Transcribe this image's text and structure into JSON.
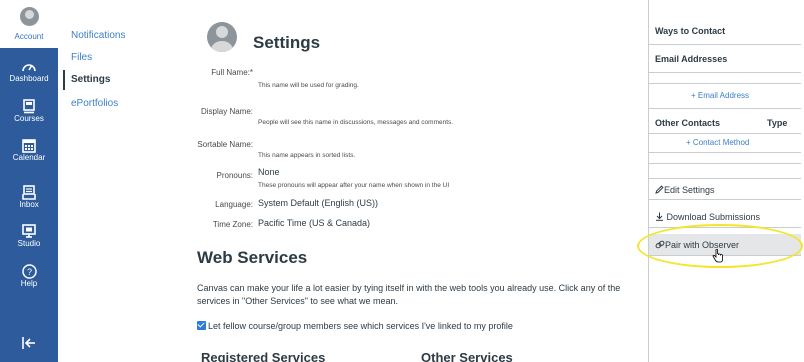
{
  "global_nav": {
    "account_label": "Account",
    "items": [
      {
        "label": "Dashboard",
        "icon": "dashboard-icon"
      },
      {
        "label": "Courses",
        "icon": "courses-icon"
      },
      {
        "label": "Calendar",
        "icon": "calendar-icon"
      },
      {
        "label": "Inbox",
        "icon": "inbox-icon"
      },
      {
        "label": "Studio",
        "icon": "studio-icon"
      },
      {
        "label": "Help",
        "icon": "help-icon"
      }
    ],
    "collapse_icon": "collapse-icon"
  },
  "left_menu": {
    "items": [
      "Notifications",
      "Files",
      "Settings",
      "ePortfolios"
    ],
    "active": "Settings"
  },
  "main": {
    "title": "Settings",
    "fields": {
      "full_name_label": "Full Name:*",
      "full_name_hint": "This name will be used for grading.",
      "display_name_label": "Display Name:",
      "display_name_hint": "People will see this name in discussions, messages and comments.",
      "sortable_name_label": "Sortable Name:",
      "sortable_name_hint": "This name appears in sorted lists.",
      "pronouns_label": "Pronouns:",
      "pronouns_value": "None",
      "pronouns_hint": "These pronouns will appear after your name when shown in the UI",
      "language_label": "Language:",
      "language_value": "System Default (English (US))",
      "timezone_label": "Time Zone:",
      "timezone_value": "Pacific Time (US & Canada)"
    },
    "web_services": {
      "title": "Web Services",
      "description": "Canvas can make your life a lot easier by tying itself in with the web tools you already use. Click any of the services in \"Other Services\" to see what we mean.",
      "checkbox_label": "Let fellow course/group members see which services I've linked to my profile",
      "registered_title": "Registered Services",
      "other_title": "Other Services"
    }
  },
  "sidebar": {
    "ways_to_contact": "Ways to Contact",
    "email_addresses": "Email Addresses",
    "add_email": "+ Email Address",
    "other_contacts": "Other Contacts",
    "type": "Type",
    "add_contact": "+ Contact Method",
    "edit_settings": "Edit Settings",
    "download_submissions": "Download Submissions",
    "pair_with_observer": "Pair with Observer"
  },
  "colors": {
    "nav_bg": "#2d5b9c",
    "link": "#3d7fc7",
    "highlight": "#f4e52c"
  }
}
